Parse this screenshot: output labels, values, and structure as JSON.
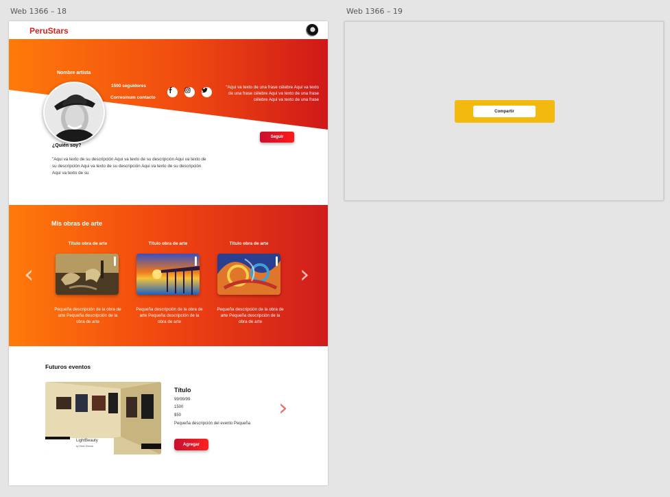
{
  "artboards": {
    "left_label": "Web 1366 – 18",
    "right_label": "Web 1366 – 19"
  },
  "header": {
    "logo": "PeruStars",
    "avatar_icon": "user-avatar-icon"
  },
  "profile": {
    "name": "Nombre artista",
    "followers": "1500 seguidores",
    "contact": "Correo/num contacto",
    "socials": [
      "facebook-icon",
      "instagram-icon",
      "twitter-icon"
    ],
    "quote": "\"Aqui va texto de una frase célebre Aqui va texto de una frase célebre Aqui va texto de una frase célebre Aqui va texto de una frase",
    "follow_label": "Seguir"
  },
  "about": {
    "title": "¿Quién soy?",
    "text": "\"Aqui va texto de su descripción Aqui va texto de su descripción Aqui va texto de su descripción Aqui va texto de su descripción Aqui va texto de su descripción Aqui va texto de su"
  },
  "artworks": {
    "title": "Mis obras de arte",
    "items": [
      {
        "title": "Título obra de arte",
        "desc": "Pequeña descripción de la obra de arte Pequeña descripción de la obra de arte"
      },
      {
        "title": "Título obra de arte",
        "desc": "Pequeña descripción de la obra de arte Pequeña descripción de la obra de arte"
      },
      {
        "title": "Título obra de arte",
        "desc": "Pequeña descripción de la obra de arte Pequeña descripción de la obra de arte"
      }
    ]
  },
  "events": {
    "title": "Futuros eventos",
    "item": {
      "name": "Título",
      "date": "99/99/99",
      "capacity": "1500",
      "price": "$50",
      "desc": "Pequeña descripción del evento Pequeña",
      "add_label": "Agregar",
      "image_caption": "LightBeauty",
      "image_subcaption": "by Ebee Kimura"
    }
  },
  "share": {
    "label": "Compartir"
  },
  "colors": {
    "brand_red": "#d62020",
    "orange": "#ff7a0a",
    "share_yellow": "#f4b90f"
  }
}
